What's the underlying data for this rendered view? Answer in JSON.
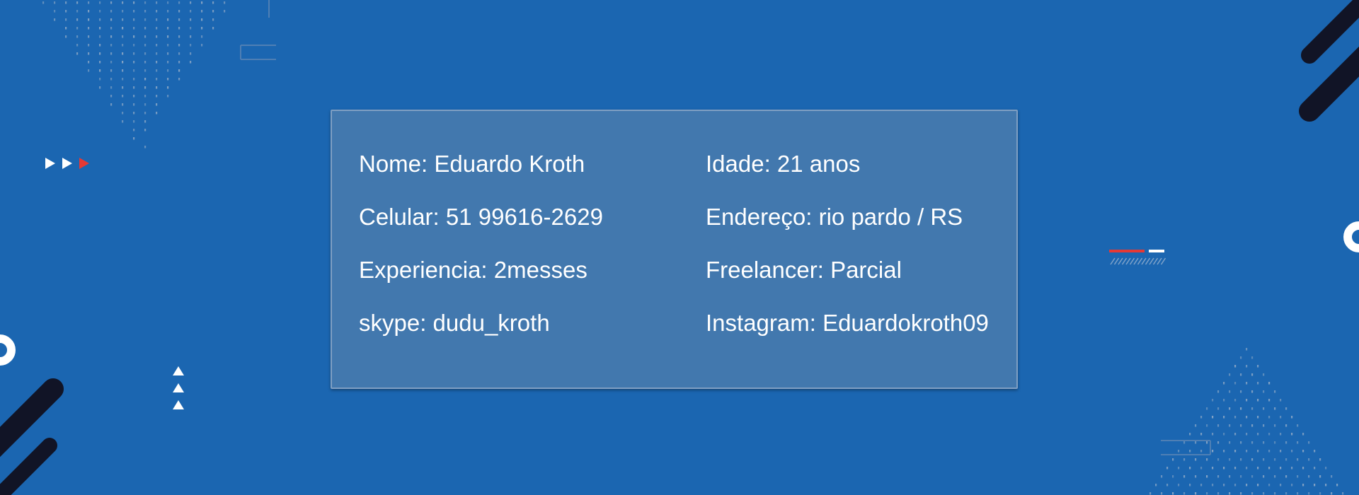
{
  "profile": {
    "fields": [
      {
        "label": "Nome",
        "value": "Eduardo Kroth"
      },
      {
        "label": "Idade",
        "value": "21 anos"
      },
      {
        "label": "Celular",
        "value": "51 99616-2629"
      },
      {
        "label": "Endereço",
        "value": "rio pardo / RS"
      },
      {
        "label": "Experiencia",
        "value": "2messes"
      },
      {
        "label": "Freelancer",
        "value": "Parcial"
      },
      {
        "label": "skype",
        "value": "dudu_kroth"
      },
      {
        "label": "Instagram",
        "value": "Eduardokroth09"
      }
    ],
    "lines": {
      "name": "Nome: Eduardo Kroth",
      "age": "Idade: 21 anos",
      "phone": "Celular: 51 99616-2629",
      "address": "Endereço: rio pardo / RS",
      "experience": "Experiencia: 2messes",
      "freelancer": "Freelancer: Parcial",
      "skype": "skype: dudu_kroth",
      "instagram": "Instagram: Eduardokroth09"
    }
  },
  "colors": {
    "background": "#1b66b1",
    "card": "#4278ae",
    "card_border": "#7f9fc3",
    "text": "#ffffff",
    "accent_red": "#e53935",
    "dark_stripe": "#111426"
  },
  "decorations": [
    "dot-pattern",
    "play-arrows-icon",
    "up-arrows-icon",
    "ring-icon",
    "diagonal-stripes",
    "dash-lines"
  ]
}
